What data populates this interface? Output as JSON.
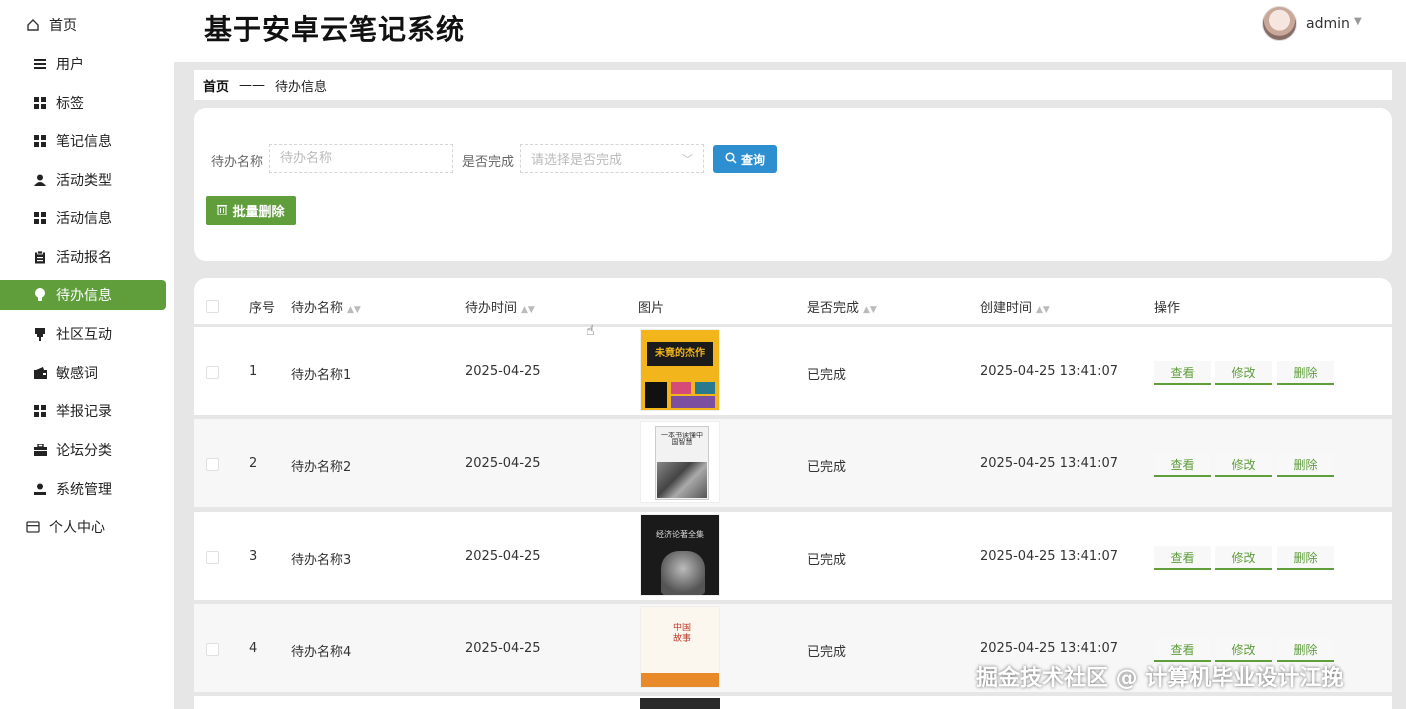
{
  "app_title": "基于安卓云笔记系统",
  "user": {
    "name": "admin"
  },
  "sidebar": {
    "items": [
      {
        "label": "首页",
        "icon": "home-icon"
      },
      {
        "label": "用户",
        "icon": "list-icon"
      },
      {
        "label": "标签",
        "icon": "grid-icon"
      },
      {
        "label": "笔记信息",
        "icon": "grid-icon"
      },
      {
        "label": "活动类型",
        "icon": "person-icon"
      },
      {
        "label": "活动信息",
        "icon": "grid-icon"
      },
      {
        "label": "活动报名",
        "icon": "clipboard-icon"
      },
      {
        "label": "待办信息",
        "icon": "bulb-icon",
        "active": true
      },
      {
        "label": "社区互动",
        "icon": "pin-icon"
      },
      {
        "label": "敏感词",
        "icon": "wallet-icon"
      },
      {
        "label": "举报记录",
        "icon": "grid-icon"
      },
      {
        "label": "论坛分类",
        "icon": "briefcase-icon"
      },
      {
        "label": "系统管理",
        "icon": "user-icon"
      },
      {
        "label": "个人中心",
        "icon": "card-icon"
      }
    ]
  },
  "breadcrumb": {
    "home": "首页",
    "separator": "——",
    "current": "待办信息"
  },
  "search": {
    "name_label": "待办名称",
    "name_placeholder": "待办名称",
    "done_label": "是否完成",
    "done_placeholder": "请选择是否完成",
    "query_label": "查询",
    "batch_delete_label": "批量删除"
  },
  "table": {
    "headers": {
      "index": "序号",
      "name": "待办名称",
      "time": "待办时间",
      "image": "图片",
      "done": "是否完成",
      "created": "创建时间",
      "ops": "操作"
    },
    "ops": {
      "view": "查看",
      "edit": "修改",
      "delete": "删除"
    },
    "rows": [
      {
        "index": "1",
        "name": "待办名称1",
        "time": "2025-04-25",
        "done": "已完成",
        "created": "2025-04-25 13:41:07",
        "book_title": "未竟的杰作"
      },
      {
        "index": "2",
        "name": "待办名称2",
        "time": "2025-04-25",
        "done": "已完成",
        "created": "2025-04-25 13:41:07",
        "book_title": "一本书读懂中国智慧"
      },
      {
        "index": "3",
        "name": "待办名称3",
        "time": "2025-04-25",
        "done": "已完成",
        "created": "2025-04-25 13:41:07",
        "book_title": "经济论著全集"
      },
      {
        "index": "4",
        "name": "待办名称4",
        "time": "2025-04-25",
        "done": "已完成",
        "created": "2025-04-25 13:41:07",
        "book_title": "中国故事"
      }
    ]
  },
  "watermark": "掘金技术社区 @ 计算机毕业设计江挽",
  "colors": {
    "accent_green": "#5f9e3b",
    "query_blue": "#2d8fd0",
    "background": "#e6e6e6"
  }
}
